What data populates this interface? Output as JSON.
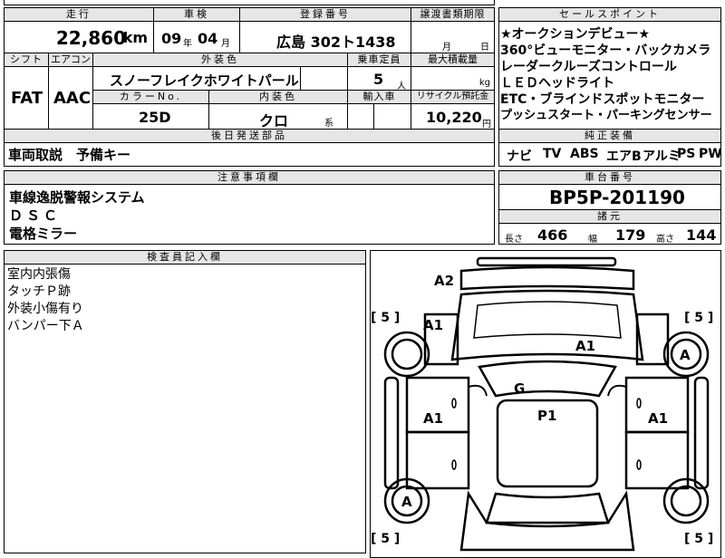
{
  "labels": {
    "mileage": "走行",
    "inspection": "車検",
    "registration": "登録番号",
    "transfer_doc": "譲渡書類期限",
    "selling_points": "セールスポイント",
    "shift": "シフト",
    "aircon": "エアコン",
    "exterior_color": "外装色",
    "capacity": "乗車定員",
    "max_load": "最大積載量",
    "color_no": "カラーNo.",
    "interior_color": "内装色",
    "import": "輸入車",
    "recycle": "リサイクル預託金",
    "later_parts": "後日発送部品",
    "genuine_equipment": "純正装備",
    "notes": "注意事項欄",
    "chassis_no": "車台番号",
    "specs": "諸元",
    "inspector_notes": "検査員記入欄"
  },
  "values": {
    "mileage": "22,860",
    "mileage_unit": "km",
    "inspection_year": "09",
    "inspection_year_unit": "年",
    "inspection_month": "04",
    "inspection_month_unit": "月",
    "registration": "広島 302ト1438",
    "transfer_month_unit": "月",
    "transfer_day_unit": "日",
    "shift": "FAT",
    "aircon": "AAC",
    "exterior_color": "スノーフレイクホワイトパール",
    "capacity": "5",
    "capacity_unit": "人",
    "load_unit": "kg",
    "color_no": "25D",
    "interior_color": "クロ",
    "interior_suffix": "系",
    "recycle": "10,220",
    "recycle_unit": "円",
    "chassis_no": "BP5P-201190"
  },
  "selling_points": [
    "★オークションデビュー★",
    "360°ビューモニター・バックカメラ",
    "レーダークルーズコントロール",
    "ＬＥＤヘッドライト",
    "ETC・ブラインドスポットモニター",
    "プッシュスタート・パーキングセンサー"
  ],
  "later_parts": "車両取説　予備キー",
  "genuine_equipment": [
    "ナビ",
    "TV",
    "ABS",
    "エアB",
    "アルミ",
    "PS",
    "PW"
  ],
  "notes": [
    "車線逸脱警報システム",
    "ＤＳＣ",
    "電格ミラー"
  ],
  "specs": {
    "length_label": "長さ",
    "length": "466",
    "width_label": "幅",
    "width": "179",
    "height_label": "高さ",
    "height": "144"
  },
  "inspector_notes": [
    "室内内張傷",
    "タッチＰ跡",
    "外装小傷有り",
    "バンパー下Ａ"
  ],
  "diagram": {
    "front_bumper": "A2",
    "front_left_fender": "A1",
    "hood": "A1",
    "roof": "G",
    "roof_panel": "P1",
    "left_door": "A1",
    "right_door": "A1",
    "front_right_wheel": "A",
    "rear_left_wheel": "A",
    "tire_fl": "[ 5 ]",
    "tire_fr": "[ 5 ]",
    "tire_rl": "[ 5 ]",
    "tire_rr": "[ 5 ]"
  }
}
